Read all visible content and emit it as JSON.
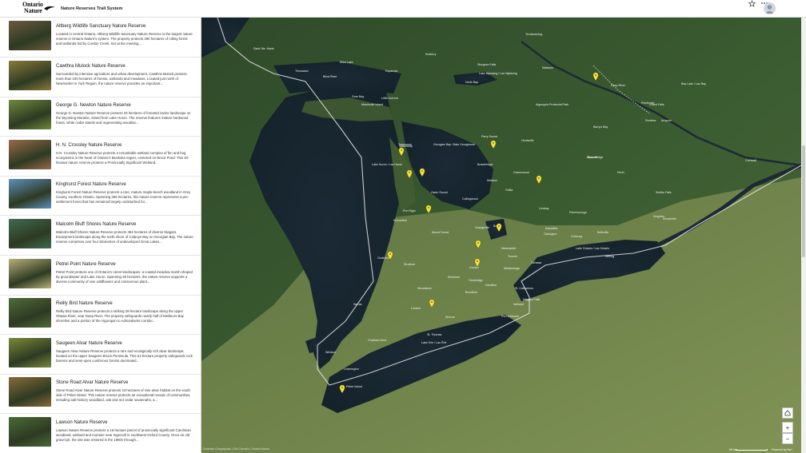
{
  "header": {
    "logo_line1": "Ontario",
    "logo_line2": "Nature",
    "app_title": "Nature Reserves Trail System",
    "favorite_icon": "star-icon",
    "more_icon": "more-icon",
    "avatar_icon": "user-avatar"
  },
  "reserves": [
    {
      "title": "Altberg Wildlife Sanctuary Nature Reserve",
      "desc": "Located in central Ontario, Altberg Wildlife Sanctuary Nature Reserve is the largest nature reserve in Ontario Nature's system. The property protects 490 hectares of rolling forest and wetlands fed by Cordon Creek. Set at the meeting...",
      "thumb": "#6b5a3e"
    },
    {
      "title": "Cawthra Mulock Nature Reserve",
      "desc": "Surrounded by intensive agriculture and urban development, Cawthra Mulock protects more than 100 hectares of forests, wetlands and meadows. Located just north of Newmarket in York Region, the nature reserve provides an important...",
      "thumb": "#8a7a3a"
    },
    {
      "title": "George G. Newton Nature Reserve",
      "desc": "George G. Newton Nature Reserve protects 33 hectares of forested ravine landscape on the Wyoming Moraine, inland from Lake Huron. The reserve features mature hardwood forest, white cedar stands and regenerating woodlan...",
      "thumb": "#6f8a3c"
    },
    {
      "title": "H. N. Crossley Nature Reserve",
      "desc": "H.N. Crossley Nature Reserve protects a remarkable wetland complex of fen and bog ecosystems in the heart of Ontario's Muskoka region, centered on Bruce Pond. This 20-hectare nature reserve protects a Provincially Significant Wetland...",
      "thumb": "#9a6a4a"
    },
    {
      "title": "Kinghurst Forest Nature Reserve",
      "desc": "Kinghurst Forest Nature Reserve protects a rare, mature maple-beech woodland in Grey County, southern Ontario. Spanning 356 hectares, this nature reserve represents a pre-settlement forest that has remained largely undisturbed for...",
      "thumb": "#5d8fb8"
    },
    {
      "title": "Malcolm Bluff Shores Nature Reserve",
      "desc": "Malcolm Bluff Shores Nature Reserve protects 454 hectares of diverse Niagara Escarpment landscape along the north shore of Colpoys Bay on Georgian Bay. The nature reserve comprises over four kilometres of undeveloped Great Lakes...",
      "thumb": "#3f6b4f"
    },
    {
      "title": "Petrel Point Nature Reserve",
      "desc": "Petrel Point protects one of Ontario's rarest landscapes: a coastal meadow-marsh shaped by groundwater and Lake Huron. Spanning 38 hectares, the nature reserve supports a diverse community of rare wildflowers and carnivorous plant...",
      "thumb": "#b7b07a"
    },
    {
      "title": "Reilly Bird Nature Reserve",
      "desc": "Reilly Bird Nature Reserve protects a striking 28-hectare landscape along the upper Ottawa River, near Deep River. The property safeguards nearly half of Meilleurs Bay shoreline and a portion of the Algonquin to Adirondacks corridor...",
      "thumb": "#4f6b3a"
    },
    {
      "title": "Saugeen Alvar Nature Reserve",
      "desc": "Saugeen Alvar Nature Reserve protects a rare and ecologically rich alvar landscape, located on the upper Saugeen Bruce Peninsula. This 61-hectare property safeguards rock barrens and semi-open coniferous forests dominated...",
      "thumb": "#7a8a3a"
    },
    {
      "title": "Stone Road Alvar Nature Reserve",
      "desc": "Stone Road Alvar Nature Reserve protects 43 hectares of rare alvar habitat on the south side of Pelee Island. This nature reserve protects an exceptional mosaic of communities, including oak-hickory woodland, oak and red cedar savannahs, a...",
      "thumb": "#8a6a3a"
    },
    {
      "title": "Lawson Nature Reserve",
      "desc": "Lawson Nature Reserve protects a 15-hectare parcel of provincially significant Carolinian woodland, wetland and moraine near Ingersoll in southwest Oxford County. Once an old gravel pit, the site was restored in the 1960s through...",
      "thumb": "#4a6a3a"
    }
  ],
  "map": {
    "attribution": "Earthstar Geographics | Esri Canada | Ontario Nature",
    "scale_label": "50 km",
    "powered_by": "Powered by Esri",
    "home_icon": "home-icon",
    "zoom_in": "+",
    "zoom_out": "−",
    "labels": [
      {
        "text": "Sault Ste. Marie"
      },
      {
        "text": "Sudbury"
      },
      {
        "text": "Elliot Lake"
      },
      {
        "text": "Blind River"
      },
      {
        "text": "Espanola"
      },
      {
        "text": "Thessalon"
      },
      {
        "text": "Manitoulin Island"
      },
      {
        "text": "Gore Bay"
      },
      {
        "text": "Little Current"
      },
      {
        "text": "Lake Huron / Lac Huron"
      },
      {
        "text": "Georgian Bay / Baie Georgienne"
      },
      {
        "text": "Tobermory"
      },
      {
        "text": "Parry Sound"
      },
      {
        "text": "Huntsville"
      },
      {
        "text": "Algonquin Provincial Park"
      },
      {
        "text": "North Bay"
      },
      {
        "text": "Sturgeon Falls"
      },
      {
        "text": "Temiscaming"
      },
      {
        "text": "Mattawa"
      },
      {
        "text": "Deep River"
      },
      {
        "text": "Pembroke"
      },
      {
        "text": "Renfrew"
      },
      {
        "text": "Arnprior"
      },
      {
        "text": "Perth"
      },
      {
        "text": "Smiths Falls"
      },
      {
        "text": "Kemptville"
      },
      {
        "text": "Cornwall"
      },
      {
        "text": "Barry's Bay"
      },
      {
        "text": "Bancroft"
      },
      {
        "text": "Gravenhurst"
      },
      {
        "text": "Bracebridge"
      },
      {
        "text": "Midland"
      },
      {
        "text": "Owen Sound"
      },
      {
        "text": "Collingwood"
      },
      {
        "text": "Orillia"
      },
      {
        "text": "Lindsay"
      },
      {
        "text": "Peterborough"
      },
      {
        "text": "Belleville"
      },
      {
        "text": "Kingston"
      },
      {
        "text": "Cobourg"
      },
      {
        "text": "Clarington"
      },
      {
        "text": "Lake Ontario / Lac Ontario"
      },
      {
        "text": "Toronto"
      },
      {
        "text": "Hamilton"
      },
      {
        "text": "St. Catharines"
      },
      {
        "text": "Niagara Falls"
      },
      {
        "text": "Welland"
      },
      {
        "text": "Brantford"
      },
      {
        "text": "Guelph"
      },
      {
        "text": "Kitchener"
      },
      {
        "text": "Woodstock"
      },
      {
        "text": "London"
      },
      {
        "text": "Stratford"
      },
      {
        "text": "Goderich"
      },
      {
        "text": "Kincardine"
      },
      {
        "text": "Port Elgin"
      },
      {
        "text": "Sarnia"
      },
      {
        "text": "St. Thomas"
      },
      {
        "text": "Chatham-Kent"
      },
      {
        "text": "Windsor"
      },
      {
        "text": "Leamington"
      },
      {
        "text": "Lake Erie / Lac Érié"
      },
      {
        "text": "Pelee Island"
      },
      {
        "text": "Simcoe"
      },
      {
        "text": "Barrie"
      },
      {
        "text": "Newmarket"
      },
      {
        "text": "Oshawa"
      },
      {
        "text": "Grand Falls"
      },
      {
        "text": "Bracebridge"
      },
      {
        "text": "Port Colborne"
      },
      {
        "text": "Mount Forest"
      },
      {
        "text": "Stirling"
      },
      {
        "text": "Tobermory"
      },
      {
        "text": "Kawartha"
      },
      {
        "text": "Orangeville"
      },
      {
        "text": "Mississauga"
      },
      {
        "text": "Cambridge"
      },
      {
        "text": "Lake Nipissing / Lac Nipissing"
      },
      {
        "text": "Bay Lake / Lac Bay"
      }
    ]
  }
}
